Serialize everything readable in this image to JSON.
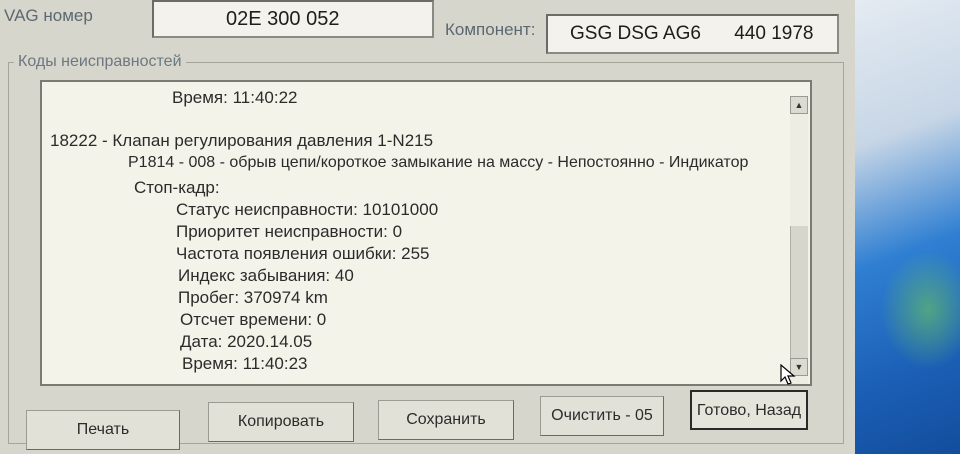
{
  "header": {
    "vag_label": "VAG номер",
    "vag_value": "02E 300 052",
    "component_label": "Компонент:",
    "component_name": "GSG DSG AG6",
    "component_code": "440 1978"
  },
  "group_title": "Коды неисправностей",
  "log_lines": {
    "l0": "Время: 11:40:22",
    "l1": "18222 - Клапан регулирования давления 1-N215",
    "l2": "P1814 - 008 - обрыв цепи/короткое замыкание на массу - Непостоянно - Индикатор",
    "l3": "Стоп-кадр:",
    "l4": "Статус неисправности: 10101000",
    "l5": "Приоритет неисправности: 0",
    "l6": "Частота появления ошибки: 255",
    "l7": "Индекс забывания: 40",
    "l8": "Пробег: 370974 km",
    "l9": "Отсчет времени: 0",
    "l10": "Дата: 2020.14.05",
    "l11": "Время: 11:40:23"
  },
  "buttons": {
    "print": "Печать",
    "copy": "Копировать",
    "save": "Сохранить",
    "clear": "Очистить - 05",
    "done": "Готово, Назад"
  },
  "icons": {
    "scroll_up": "scroll-up-arrow-icon",
    "scroll_down": "scroll-down-arrow-icon",
    "cursor": "mouse-pointer-icon"
  }
}
